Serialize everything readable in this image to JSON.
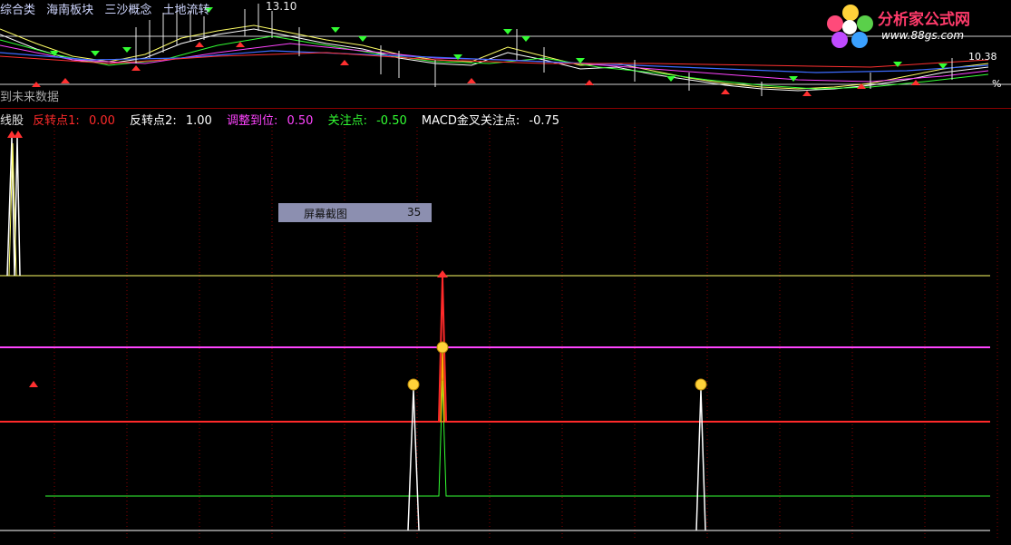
{
  "top_panel": {
    "tags": [
      "综合类",
      "海南板块",
      "三沙概念",
      "土地流转"
    ],
    "high_price": "13.10",
    "right_price": "10.38",
    "future_label": "到未来数据",
    "pct_label": "%"
  },
  "brand": {
    "title": "分析家公式网",
    "url": "www.88gs.com"
  },
  "legend": {
    "prefix": "线股",
    "items": [
      {
        "label": "反转点1:",
        "value": "0.00",
        "color": "#ff2a2a"
      },
      {
        "label": "反转点2:",
        "value": "1.00",
        "color": "#ffffff"
      },
      {
        "label": "调整到位:",
        "value": "0.50",
        "color": "#ff44ff"
      },
      {
        "label": "关注点:",
        "value": "-0.50",
        "color": "#33ff33"
      },
      {
        "label": "MACD金叉关注点:",
        "value": "-0.75",
        "color": "#ffffff"
      }
    ]
  },
  "screenshot_chip": {
    "label": "屏幕截图",
    "count": "35"
  },
  "colors": {
    "background": "#000000",
    "grid": "#8b0000",
    "yellow_line": "#ffff66",
    "magenta_line": "#ff44ff",
    "red_line": "#ff2a2a",
    "green_line": "#33ff33",
    "white_line": "#ffffff"
  }
}
